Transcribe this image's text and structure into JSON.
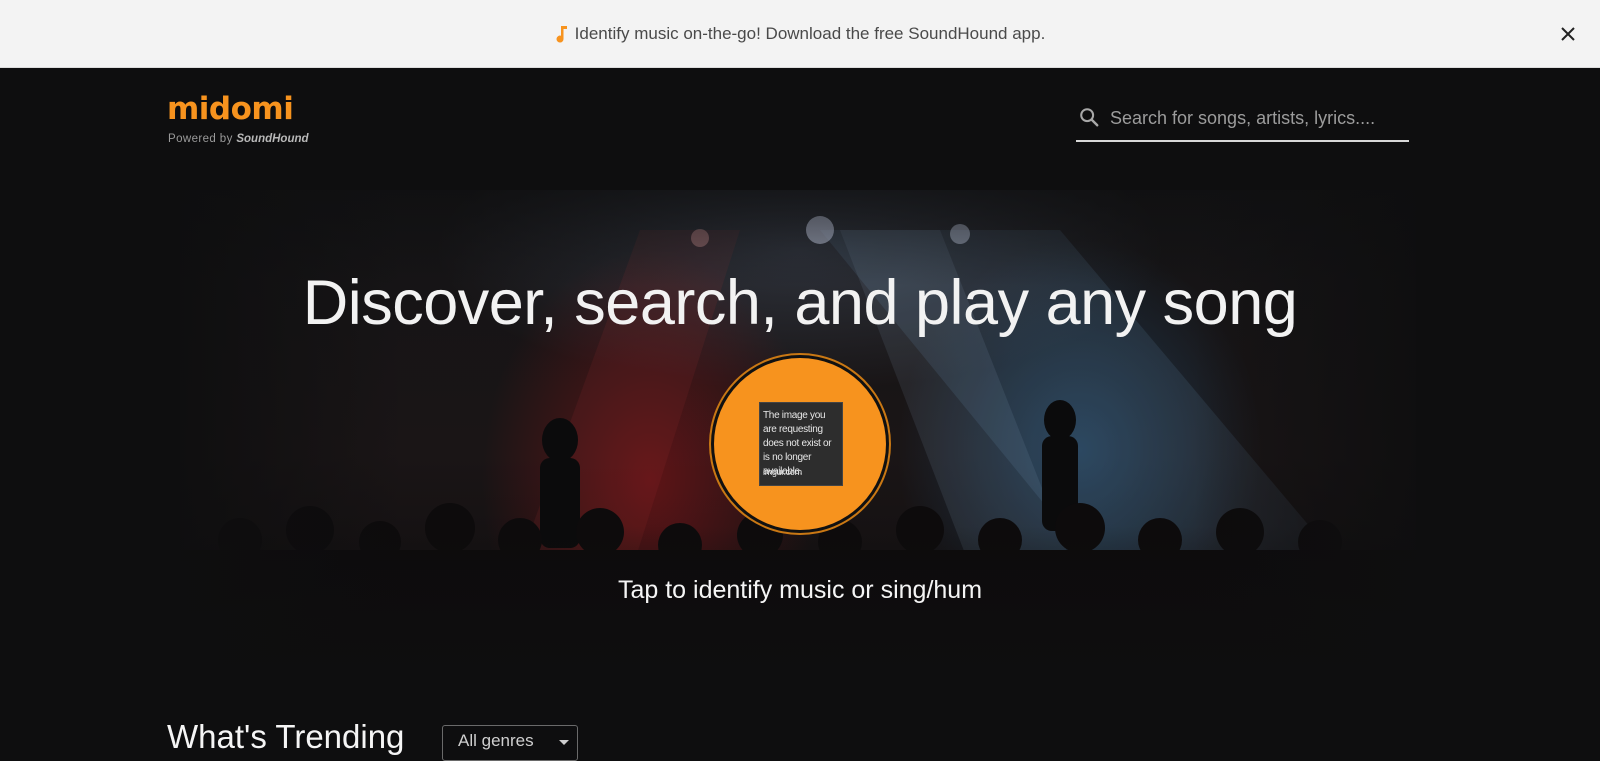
{
  "banner": {
    "message": "Identify music on-the-go! Download the free SoundHound app.",
    "icon": "music-note-icon",
    "close_icon": "close-icon"
  },
  "header": {
    "logo_text": "midomi",
    "powered_by": "Powered by",
    "powered_brand": "SoundHound",
    "search": {
      "placeholder": "Search for songs, artists, lyrics....",
      "value": "",
      "icon": "search-icon"
    }
  },
  "hero": {
    "title": "Discover, search, and play any song",
    "button_image_text": "The image you are requesting does not exist or is no longer available.",
    "button_image_source": "imgur.com",
    "tap_text": "Tap to identify music or sing/hum"
  },
  "trending": {
    "title": "What's Trending",
    "genre_selected": "All genres"
  },
  "colors": {
    "accent": "#f7931e",
    "background": "#0e0e0f",
    "banner_bg": "#f3f3f3"
  }
}
